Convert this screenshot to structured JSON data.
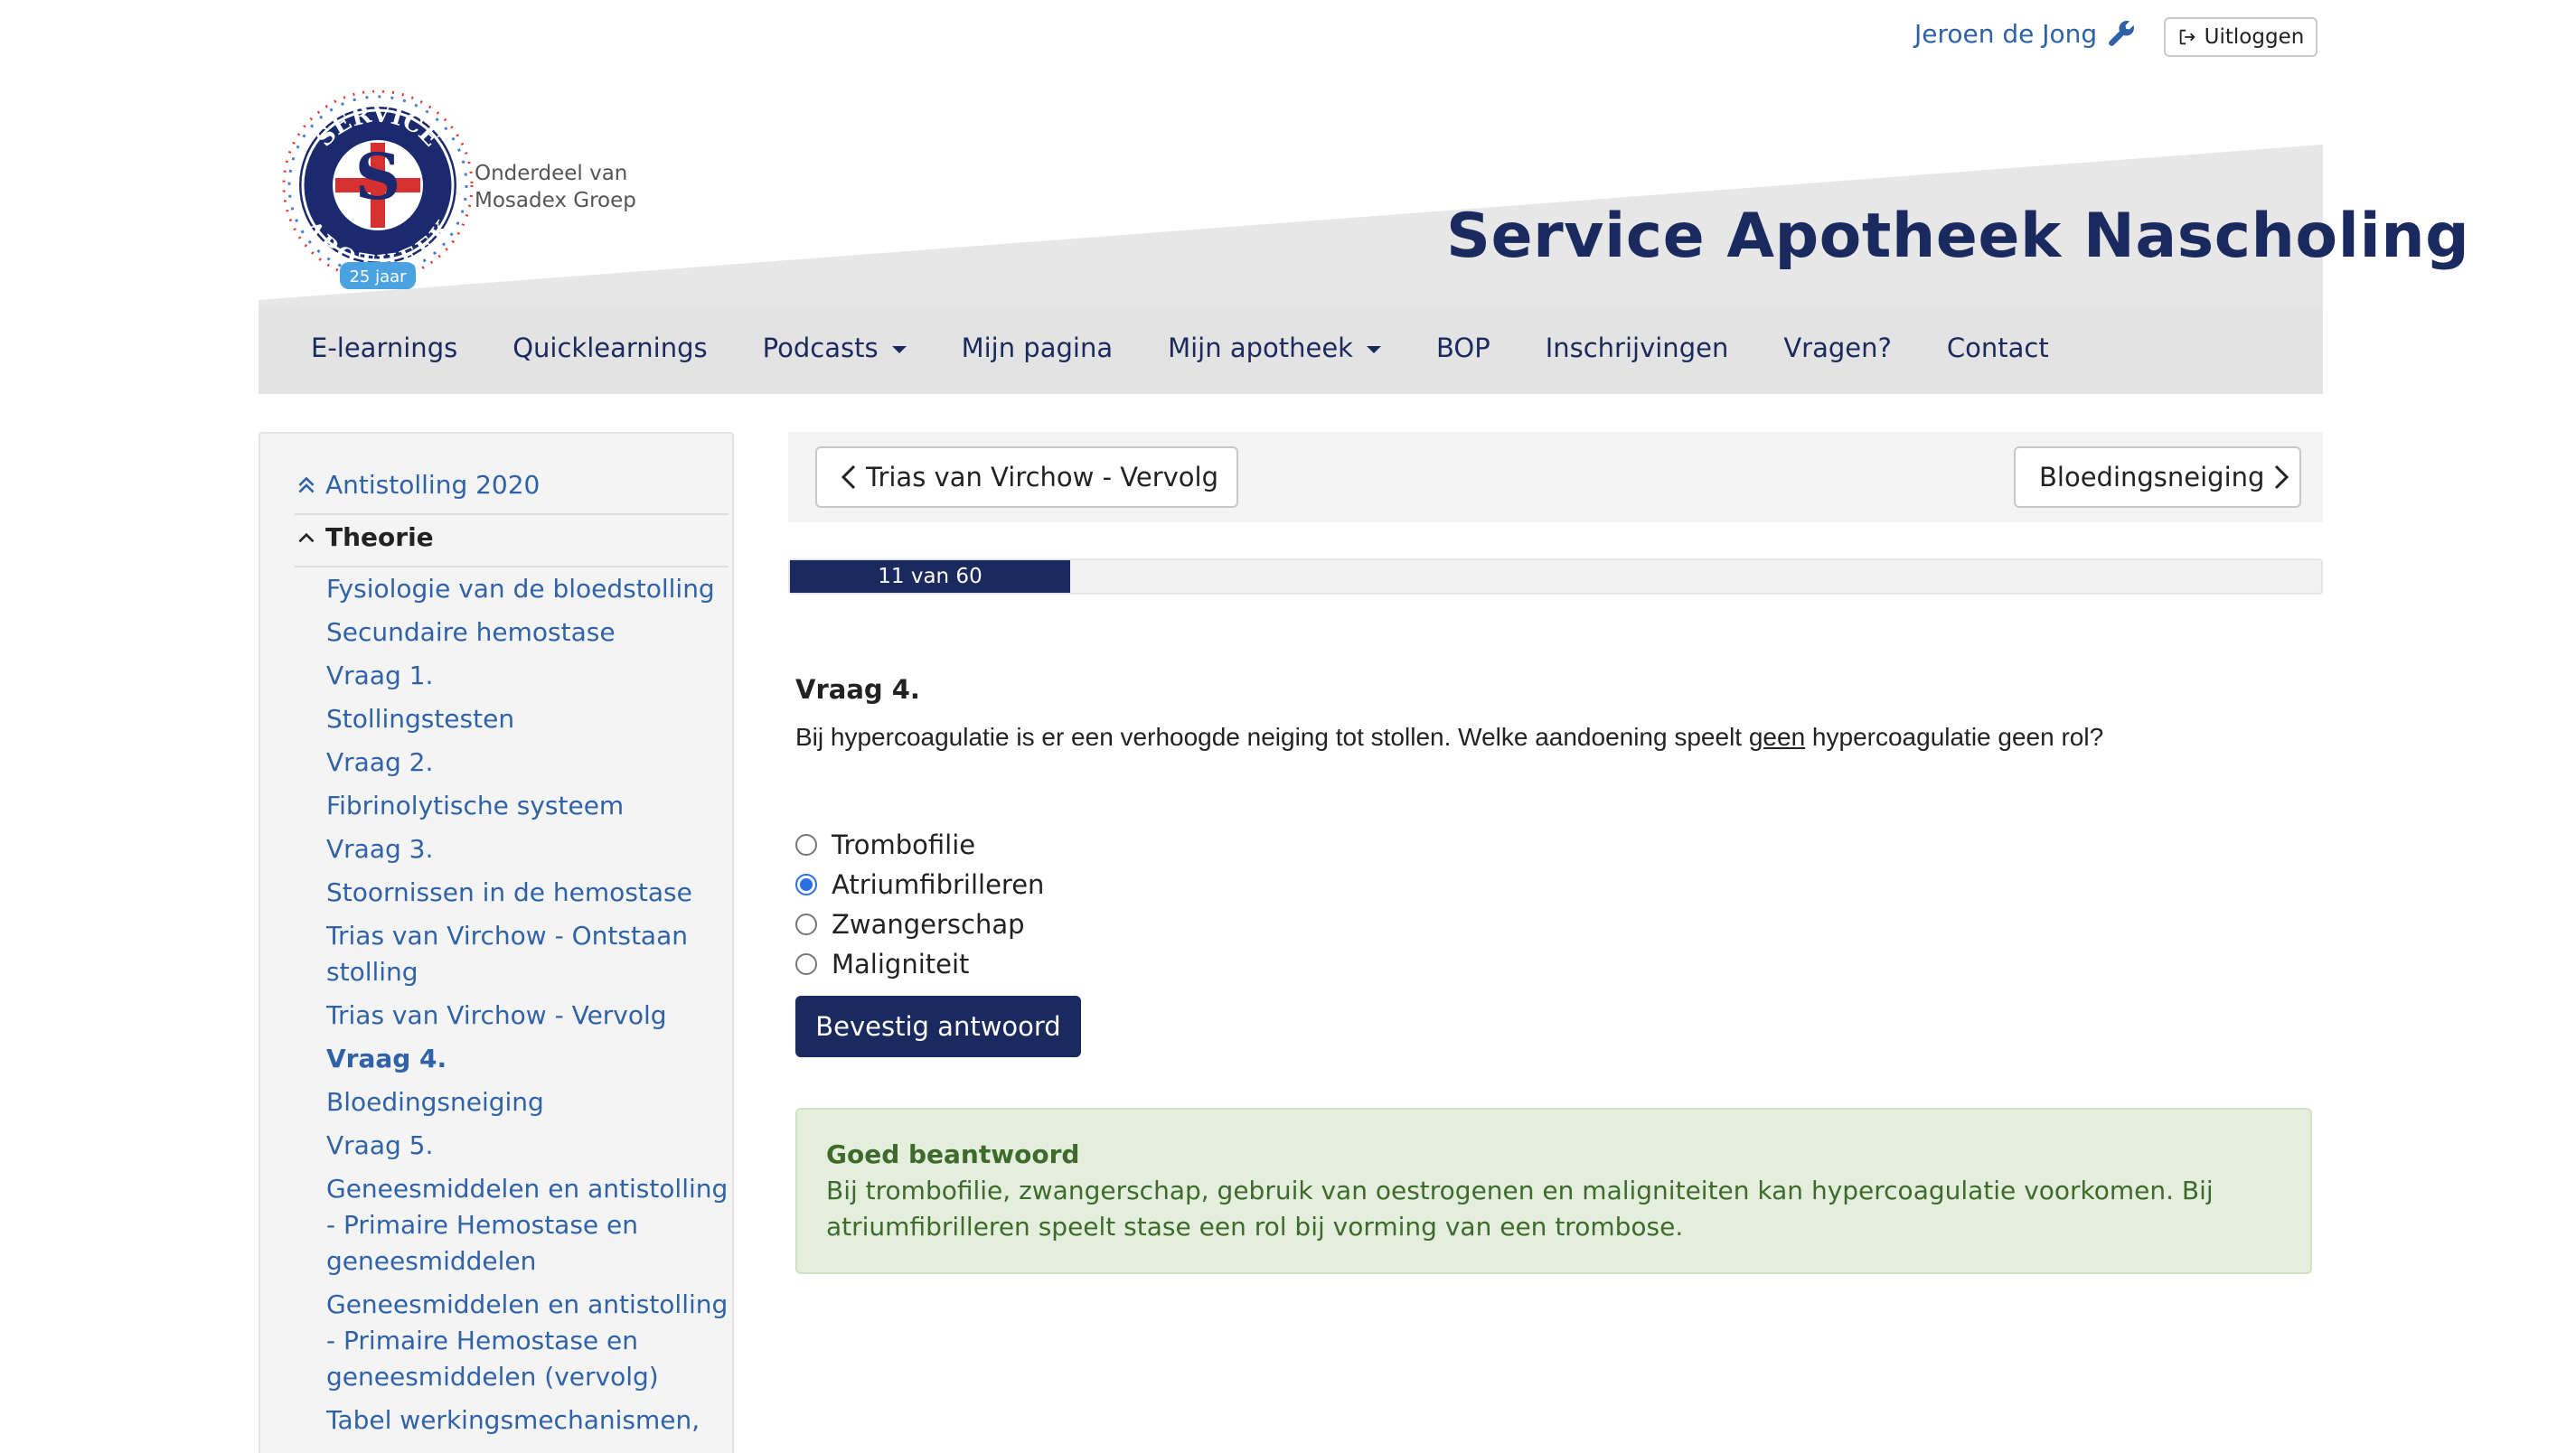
{
  "user": {
    "name": "Jeroen de Jong",
    "logout_label": "Uitloggen"
  },
  "header": {
    "logo_text_top": "SERVICE",
    "logo_text_bottom": "APOTHEEK",
    "logo_badge": "25 jaar",
    "subbrand_line1": "Onderdeel van",
    "subbrand_line2": "Mosadex Groep",
    "title": "Service Apotheek Nascholing"
  },
  "nav": {
    "items": [
      {
        "label": "E-learnings"
      },
      {
        "label": "Quicklearnings"
      },
      {
        "label": "Podcasts"
      },
      {
        "label": "Mijn pagina"
      },
      {
        "label": "Mijn apotheek"
      },
      {
        "label": "BOP"
      },
      {
        "label": "Inschrijvingen"
      },
      {
        "label": "Vragen?"
      },
      {
        "label": "Contact"
      }
    ]
  },
  "sidebar": {
    "course": "Antistolling 2020",
    "section": "Theorie",
    "items": [
      {
        "label": "Fysiologie van de bloedstolling"
      },
      {
        "label": "Secundaire hemostase"
      },
      {
        "label": "Vraag 1."
      },
      {
        "label": "Stollingstesten"
      },
      {
        "label": "Vraag 2."
      },
      {
        "label": "Fibrinolytische systeem"
      },
      {
        "label": "Vraag 3."
      },
      {
        "label": "Stoornissen in de hemostase"
      },
      {
        "label": "Trias van Virchow - Ontstaan stolling"
      },
      {
        "label": "Trias van Virchow - Vervolg"
      },
      {
        "label": "Vraag 4."
      },
      {
        "label": "Bloedingsneiging"
      },
      {
        "label": "Vraag 5."
      },
      {
        "label": "Geneesmiddelen en antistolling - Primaire Hemostase en geneesmiddelen"
      },
      {
        "label": "Geneesmiddelen en antistolling - Primaire Hemostase en geneesmiddelen (vervolg)"
      },
      {
        "label": "Tabel werkingsmechanismen,"
      }
    ]
  },
  "pager": {
    "prev_label": "Trias van Virchow - Vervolg",
    "next_label": "Bloedingsneiging",
    "progress_text": "11 van 60",
    "progress_fraction": 0.183
  },
  "question": {
    "title": "Vraag 4.",
    "text_before": "Bij hypercoagulatie is er een verhoogde neiging tot stollen. Welke aandoening speelt ",
    "text_underlined": "geen",
    "text_after": " hypercoagulatie geen rol?",
    "options": [
      {
        "label": "Trombofilie",
        "checked": false
      },
      {
        "label": "Atriumfibrilleren",
        "checked": true
      },
      {
        "label": "Zwangerschap",
        "checked": false
      },
      {
        "label": "Maligniteit",
        "checked": false
      }
    ],
    "confirm_label": "Bevestig antwoord"
  },
  "feedback": {
    "title": "Goed beantwoord",
    "text": "Bij trombofilie, zwangerschap, gebruik van oestrogenen en maligniteiten kan hypercoagulatie voorkomen. Bij atriumfibrilleren speelt stase een rol bij vorming van een trombose."
  },
  "colors": {
    "navy": "#1b2a5e",
    "link_blue": "#2f62a7",
    "success_bg": "#e3efdc",
    "success_text": "#3e6a2c"
  }
}
